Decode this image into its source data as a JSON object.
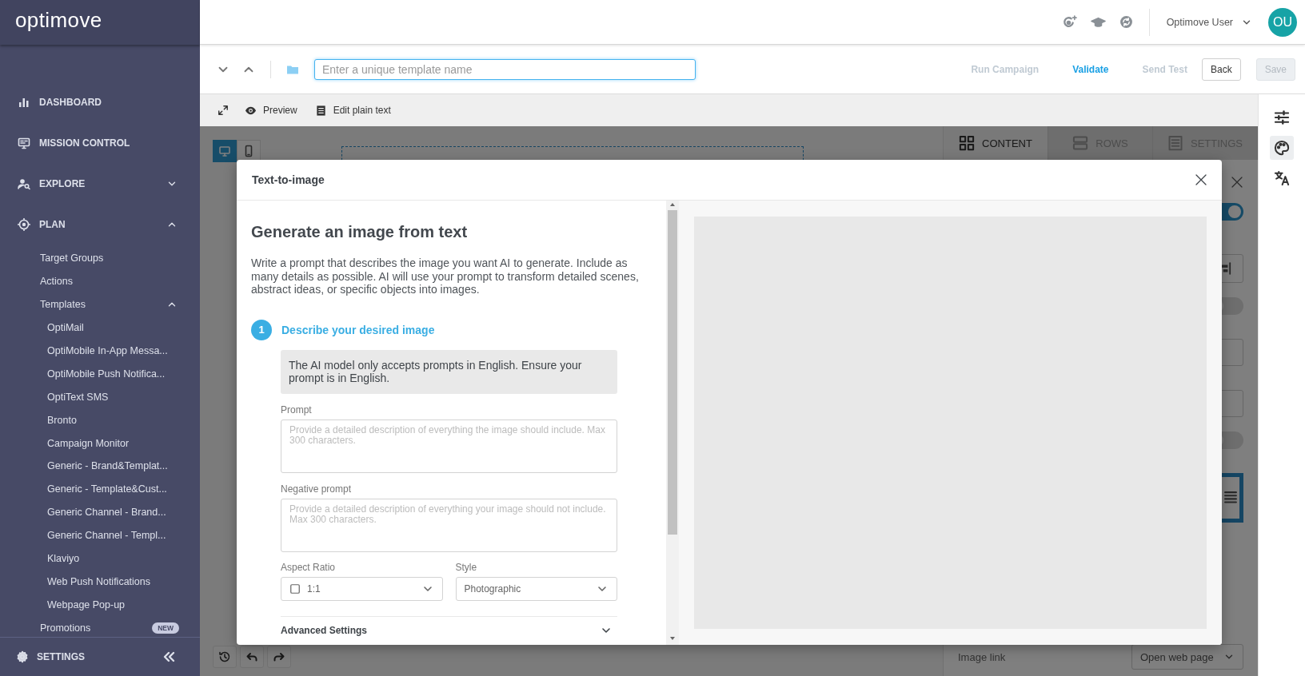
{
  "sidebar": {
    "logo": "optimove",
    "nav": [
      {
        "label": "DASHBOARD"
      },
      {
        "label": "MISSION CONTROL"
      },
      {
        "label": "EXPLORE",
        "expanded": false
      },
      {
        "label": "PLAN",
        "expanded": true,
        "children": [
          {
            "label": "Target Groups"
          },
          {
            "label": "Actions"
          },
          {
            "label": "Templates",
            "expanded": true,
            "children": [
              {
                "label": "OptiMail"
              },
              {
                "label": "OptiMobile In-App Messa..."
              },
              {
                "label": "OptiMobile Push Notifica..."
              },
              {
                "label": "OptiText SMS"
              },
              {
                "label": "Bronto"
              },
              {
                "label": "Campaign Monitor"
              },
              {
                "label": "Generic - Brand&Templat..."
              },
              {
                "label": "Generic - Template&Cust..."
              },
              {
                "label": "Generic Channel - Brand..."
              },
              {
                "label": "Generic Channel - Templ..."
              },
              {
                "label": "Klaviyo"
              },
              {
                "label": "Web Push Notifications"
              },
              {
                "label": "Webpage Pop-up"
              }
            ]
          },
          {
            "label": "Promotions",
            "badge": "NEW"
          }
        ]
      }
    ],
    "footer": {
      "label": "SETTINGS"
    }
  },
  "topbar": {
    "user": "Optimove User",
    "avatar": "OU"
  },
  "toolbar": {
    "name_placeholder": "Enter a unique template name",
    "actions": [
      {
        "label": "Run Campaign",
        "disabled": true
      },
      {
        "label": "Validate",
        "disabled": false
      },
      {
        "label": "Send Test",
        "disabled": true
      }
    ],
    "buttons": [
      {
        "label": "Back",
        "disabled": false
      },
      {
        "label": "Save",
        "disabled": true
      }
    ]
  },
  "subbar": [
    {
      "label": "Preview"
    },
    {
      "label": "Edit plain text"
    }
  ],
  "editor": {
    "devices": [
      {
        "selected": true
      },
      {
        "selected": false
      }
    ],
    "panel": {
      "tabs": [
        {
          "label": "CONTENT",
          "selected": true
        },
        {
          "label": "ROWS",
          "selected": false
        },
        {
          "label": "SETTINGS",
          "selected": false
        }
      ],
      "controls": [
        {
          "kind": "toggle",
          "on": true
        },
        {
          "kind": "align"
        },
        {
          "kind": "toggle",
          "on": false
        },
        {
          "kind": "input"
        },
        {
          "kind": "input"
        },
        {
          "kind": "toggle",
          "on": false
        },
        {
          "kind": "image"
        }
      ],
      "image_link": {
        "label": "Image link",
        "value": "Open web page"
      }
    }
  },
  "rail": [
    {
      "selected": false
    },
    {
      "selected": true
    },
    {
      "selected": false
    }
  ],
  "modal": {
    "title": "Text-to-image",
    "heading": "Generate an image from text",
    "intro": "Write a prompt that describes the image you want AI to generate. Include as many details as possible. AI will use your prompt to transform detailed scenes, abstract ideas, or specific objects into images.",
    "step": {
      "number": "1",
      "title": "Describe your desired image"
    },
    "notice": "The AI model only accepts prompts in English. Ensure your prompt is in English.",
    "fields": [
      {
        "label": "Prompt",
        "placeholder": "Provide a detailed description of everything the image should include. Max 300 characters."
      },
      {
        "label": "Negative prompt",
        "placeholder": "Provide a detailed description of everything your image should not include. Max 300 characters."
      }
    ],
    "selects": [
      {
        "label": "Aspect Ratio",
        "value": "1:1",
        "kind": "ratio"
      },
      {
        "label": "Style",
        "value": "Photographic",
        "kind": "plain"
      }
    ],
    "advanced": {
      "label": "Advanced Settings",
      "expanded": false
    }
  }
}
